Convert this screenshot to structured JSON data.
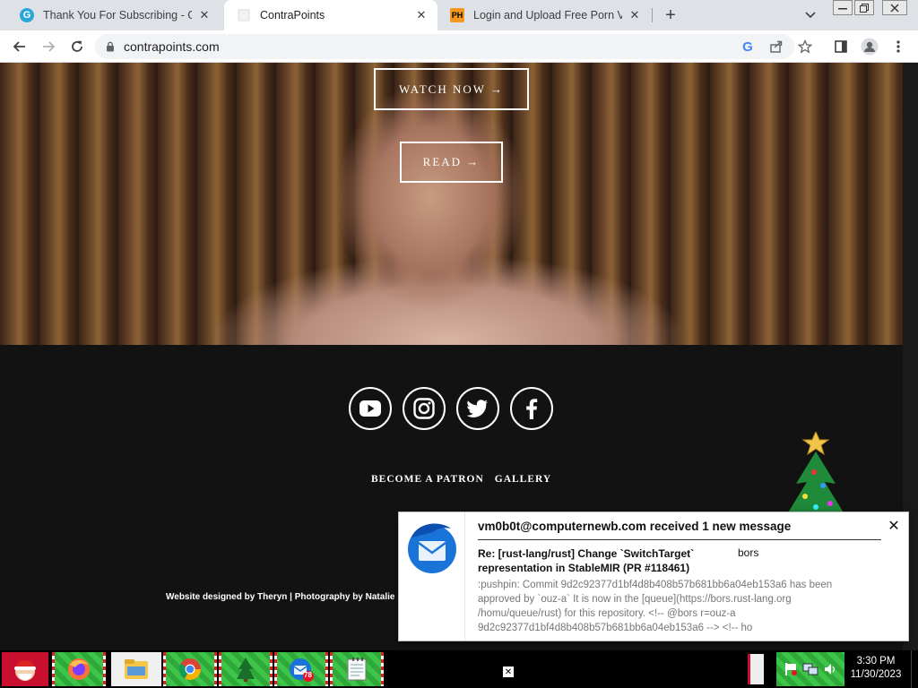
{
  "browser": {
    "tabs": [
      {
        "title": "Thank You For Subscribing - Goo",
        "favicon": "G"
      },
      {
        "title": "ContraPoints",
        "favicon": ""
      },
      {
        "title": "Login and Upload Free Porn Vide",
        "favicon": "PH"
      }
    ],
    "url": "contrapoints.com"
  },
  "page": {
    "hero_buttons": {
      "watch": "WATCH NOW →",
      "read": "READ →"
    },
    "social_icons": [
      "youtube-icon",
      "instagram-icon",
      "twitter-icon",
      "facebook-icon"
    ],
    "footer_links": [
      "BECOME A PATRON",
      "GALLERY"
    ],
    "credits": "Website designed by Theryn | Photography by Natalie"
  },
  "notification": {
    "title": "vm0b0t@computernewb.com received 1 new message",
    "subject": "Re: [rust-lang/rust] Change `SwitchTarget` representation in StableMIR (PR #118461)",
    "from": "bors",
    "body": ":pushpin: Commit 9d2c92377d1bf4d8b408b57b681bb6a04eb153a6 has been approved by `ouz-a` It is now in the [queue](https://bors.rust-lang.org /homu/queue/rust) for this repository. <!-- @bors r=ouz-a 9d2c92377d1bf4d8b408b57b681bb6a04eb153a6 --> <!-- ho"
  },
  "taskbar": {
    "apps": [
      "santa-icon",
      "firefox-icon",
      "file-explorer-icon",
      "chrome-icon",
      "tree-icon",
      "thunderbird-icon",
      "notepad-icon"
    ],
    "thunderbird_badge": "78",
    "time": "3:30 PM",
    "date": "11/30/2023"
  },
  "colors": {
    "tab_strip": "#dee1e6",
    "page_bg": "#121212",
    "taskbar_green": "#2fa83a"
  }
}
